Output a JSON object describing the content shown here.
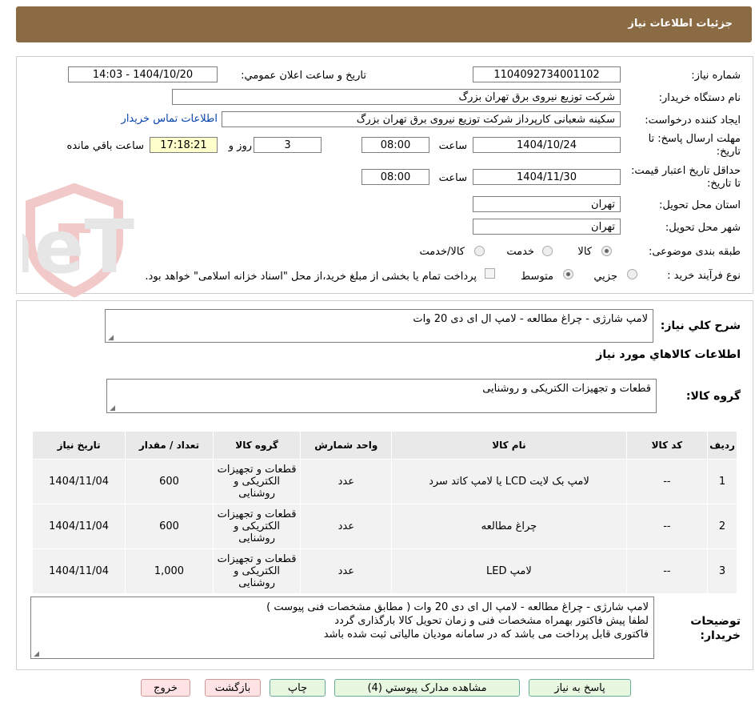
{
  "window": {
    "title": "جزئیات اطلاعات نیاز"
  },
  "colors": {
    "title_bar": "#8b6b44",
    "link": "#0645ad",
    "time_highlight": "#ffffcc"
  },
  "watermark": {
    "text": "AriaTender.neT"
  },
  "form": {
    "need_number_label": "شماره نیاز:",
    "need_number": "1104092734001102",
    "announce_label": "تاریخ و ساعت اعلان عمومي:",
    "announce_value": "1404/10/20 - 14:03",
    "buyer_org_label": "نام دستگاه خریدار:",
    "buyer_org": "شرکت توزیع نیروی برق تهران بزرگ",
    "requester_label": "ایجاد کننده درخواست:",
    "requester": "سکینه شعبانی کارپرداز شرکت توزیع نیروی برق تهران بزرگ",
    "contact_link": "اطلاعات تماس خریدار",
    "deadline_label": "مهلت ارسال پاسخ: تا تاریخ:",
    "deadline_date": "1404/10/24",
    "time_word": "ساعت",
    "deadline_time": "08:00",
    "days": "3",
    "days_word": "روز و",
    "remaining_time": "17:18:21",
    "remaining_word": "ساعت باقي مانده",
    "validity_label": "حداقل تاریخ اعتبار قیمت: تا تاریخ:",
    "validity_date": "1404/11/30",
    "validity_time": "08:00",
    "province_label": "استان محل تحویل:",
    "province": "تهران",
    "city_label": "شهر محل تحویل:",
    "city": "تهران",
    "category_label": "طبقه بندی موضوعی:",
    "category_options": [
      "کالا",
      "خدمت",
      "کالا/خدمت"
    ],
    "category_selected": "کالا",
    "process_label": "نوع فرآیند خرید :",
    "process_options": [
      "جزيي",
      "متوسط"
    ],
    "process_selected": "متوسط",
    "payment_note": "پرداخت تمام یا بخشی از مبلغ خرید،از محل \"اسناد خزانه اسلامی\" خواهد بود."
  },
  "summary": {
    "label": "شرح کلي نياز:",
    "text": "لامپ شارژی - چراغ مطالعه - لامپ ال ای دی 20 وات"
  },
  "goods": {
    "section_title": "اطلاعات کالاهاي مورد نياز",
    "group_label": "گروه کالا:",
    "group_value": "قطعات و تجهیزات الکتریکی و روشنایی"
  },
  "table": {
    "headers": [
      "رديف",
      "کد کالا",
      "نام کالا",
      "واحد شمارش",
      "گروه کالا",
      "تعداد / مقدار",
      "تاریخ نیاز"
    ],
    "rows": [
      {
        "idx": "1",
        "code": "--",
        "name": "لامپ بک لایت LCD یا لامپ کاتد سرد",
        "unit": "عدد",
        "group": "قطعات و تجهیزات الکتریکی و روشنایی",
        "qty": "600",
        "date": "1404/11/04"
      },
      {
        "idx": "2",
        "code": "--",
        "name": "چراغ مطالعه",
        "unit": "عدد",
        "group": "قطعات و تجهیزات الکتریکی و روشنایی",
        "qty": "600",
        "date": "1404/11/04"
      },
      {
        "idx": "3",
        "code": "--",
        "name": "لامپ LED",
        "unit": "عدد",
        "group": "قطعات و تجهیزات الکتریکی و روشنایی",
        "qty": "1,000",
        "date": "1404/11/04"
      }
    ]
  },
  "buyer_notes": {
    "label": "توضیحات خریدار:",
    "lines": [
      "لامپ شارژی - چراغ مطالعه - لامپ ال ای دی 20 وات ( مطابق مشخصات فنی پیوست )",
      "لطفا پیش فاکتور بهمراه مشخصات فنی و زمان تحویل کالا بارگذاری گردد",
      "فاکتوری قابل پرداخت می باشد که در سامانه مودیان مالیاتی ثبت شده باشد"
    ]
  },
  "buttons": {
    "reply": "پاسخ به نیاز",
    "attachments": "مشاهده مدارک پیوستي (4)",
    "print": "چاپ",
    "back": "بازگشت",
    "exit": "خروج"
  }
}
